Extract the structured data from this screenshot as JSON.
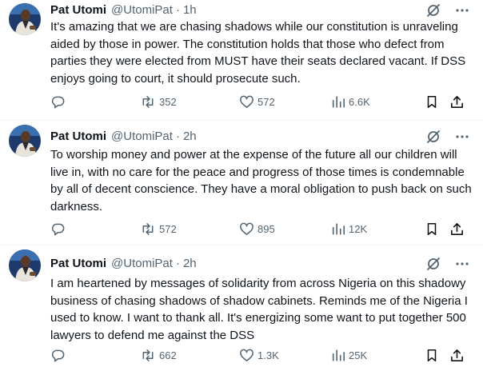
{
  "tweets": [
    {
      "author_name": "Pat Utomi",
      "handle": "@UtomiPat",
      "separator": "·",
      "time": "1h",
      "text": "It's amazing that we are chasing shadows while our constitution is unraveling aided by those in power. The constitution holds that those who defect from parties they were elected from MUST have their seats declared vacant. If DSS enjoys going to court, it should prosecute such.",
      "reposts": "352",
      "likes": "572",
      "views": "6.6K"
    },
    {
      "author_name": "Pat Utomi",
      "handle": "@UtomiPat",
      "separator": "·",
      "time": "2h",
      "text": "To worship money and power at the expense of the future all our children will live in, with no care for the peace and progress of those times is condemnable by all of decent conscience. They have a moral obligation to push back on such darkness.",
      "reposts": "572",
      "likes": "895",
      "views": "12K"
    },
    {
      "author_name": "Pat Utomi",
      "handle": "@UtomiPat",
      "separator": "·",
      "time": "2h",
      "text": "I am heartened by messages of solidarity from across Nigeria on this shadowy business of chasing shadows of shadow cabinets. Reminds me of the Nigeria I used to know. I want to thank all. It's energizing some want to put together 500 lawyers to defend me against the DSS",
      "reposts": "662",
      "likes": "1.3K",
      "views": "25K"
    }
  ],
  "icons": {
    "reply": "reply-icon",
    "repost": "repost-icon",
    "like": "heart-icon",
    "views": "views-chart-icon",
    "bookmark": "bookmark-icon",
    "share": "share-icon",
    "grok": "grok-icon",
    "more": "more-dots-icon"
  },
  "colors": {
    "text": "#0f1419",
    "secondary": "#536471",
    "divider": "#eff3f4"
  }
}
